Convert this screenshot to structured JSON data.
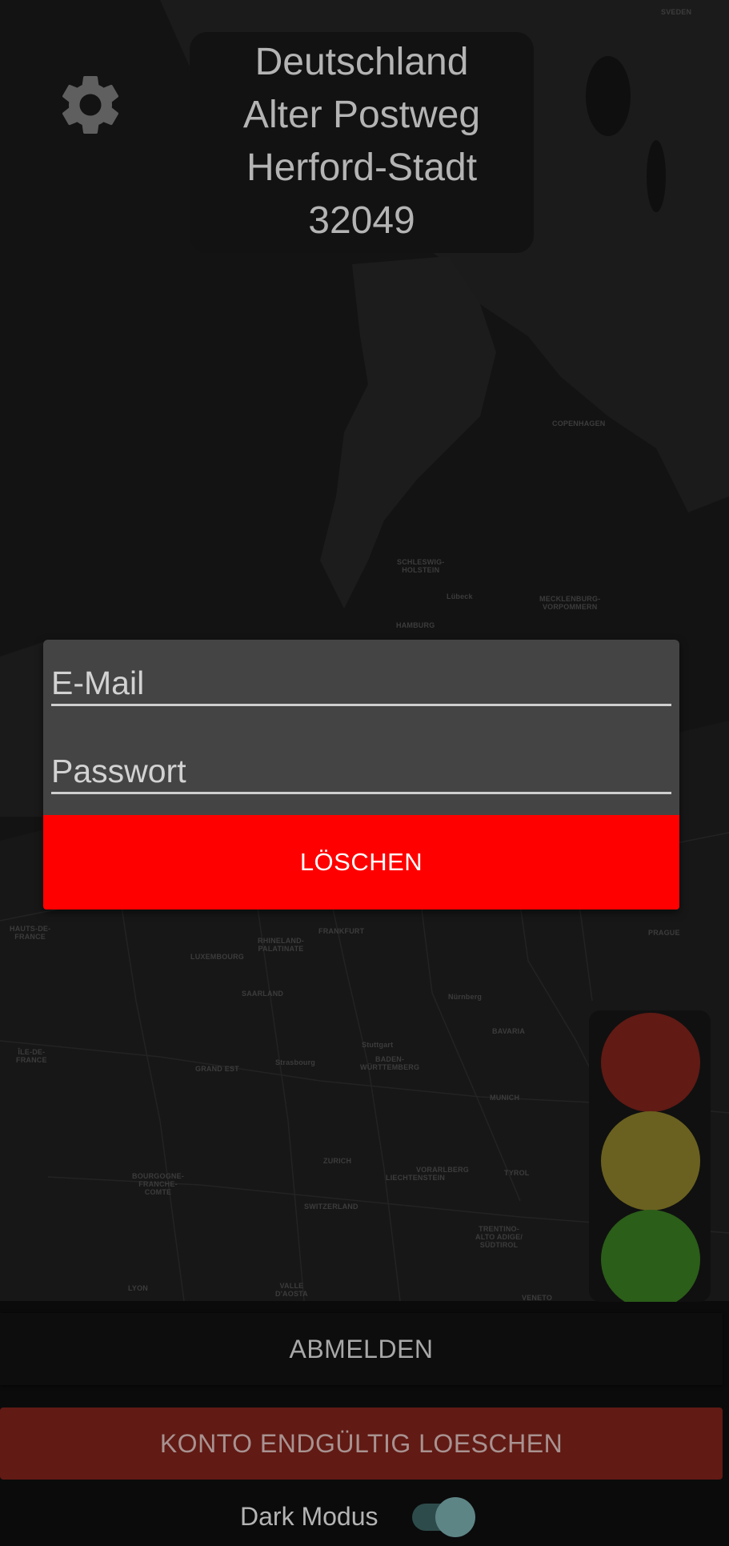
{
  "map": {
    "labels": [
      "SVEDEN",
      "COPENHAGEN",
      "SCHLESWIG-\nHOLSTEIN",
      "MECKLENBURG-\nVORPOMMERN",
      "HAMBURG",
      "Lübeck",
      "HAUTS-DE-\nFRANCE",
      "FRANKFURT",
      "RHINELAND-\nPALATINATE",
      "LUXEMBOURG",
      "SAARLAND",
      "ÎLE-DE-\nFRANCE",
      "GRAND EST",
      "BADEN-\nWÜRTTEMBERG",
      "BAVARIA",
      "MUNICH",
      "BOURGOGNE-\nFRANCHE-\nCOMTE",
      "ZURICH",
      "SWITZERLAND",
      "LIECHTENSTEIN",
      "VORARLBERG",
      "TYROL",
      "TRENTINO-\nALTO ADIGE/\nSÜDTIROL",
      "VALLE\nD'AOSTA",
      "LYON",
      "VENETO",
      "PRAGUE",
      "Nürnberg",
      "Stuttgart",
      "Strasbourg"
    ]
  },
  "address": {
    "country": "Deutschland",
    "street": "Alter Postweg",
    "city": "Herford-Stadt",
    "postcode": "32049"
  },
  "dialog": {
    "email_placeholder": "E-Mail",
    "password_placeholder": "Passwort",
    "delete_label": "LÖSCHEN"
  },
  "traffic_light": {
    "colors": {
      "red": "#611a14",
      "yellow": "#6a6120",
      "green": "#2b5e19"
    }
  },
  "buttons": {
    "logout_label": "ABMELDEN",
    "delete_account_label": "KONTO ENDGÜLTIG LOESCHEN"
  },
  "dark_mode": {
    "label": "Dark Modus",
    "enabled": true
  },
  "icons": {
    "settings": "gear-icon"
  }
}
